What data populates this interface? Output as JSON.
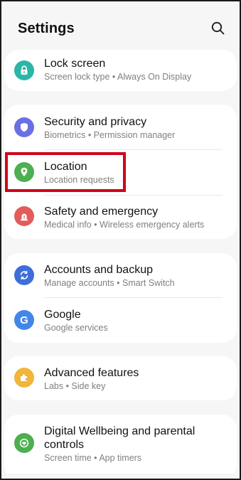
{
  "header": {
    "title": "Settings",
    "search_icon": "search-icon"
  },
  "groups": [
    {
      "items": [
        {
          "label": "Lock screen",
          "sub": "Screen lock type  •  Always On Display",
          "icon": "lock-icon",
          "color": "#2bb5a7"
        }
      ]
    },
    {
      "items": [
        {
          "label": "Security and privacy",
          "sub": "Biometrics  •  Permission manager",
          "icon": "shield-icon",
          "color": "#6a6fe3"
        },
        {
          "label": "Location",
          "sub": "Location requests",
          "icon": "location-pin-icon",
          "color": "#4caf50"
        },
        {
          "label": "Safety and emergency",
          "sub": "Medical info  •  Wireless emergency alerts",
          "icon": "alert-icon",
          "color": "#e25c5c"
        }
      ]
    },
    {
      "items": [
        {
          "label": "Accounts and backup",
          "sub": "Manage accounts  •  Smart Switch",
          "icon": "sync-icon",
          "color": "#3f6ed8"
        },
        {
          "label": "Google",
          "sub": "Google services",
          "icon": "google-icon",
          "color": "#4386ea"
        }
      ]
    },
    {
      "items": [
        {
          "label": "Advanced features",
          "sub": "Labs  •  Side key",
          "icon": "puzzle-icon",
          "color": "#f1b53a"
        }
      ]
    },
    {
      "items": [
        {
          "label": "Digital Wellbeing and parental",
          "label2": "controls",
          "sub": "Screen time  •  App timers",
          "icon": "wellbeing-icon",
          "color": "#4caf50"
        }
      ]
    }
  ],
  "highlight_color": "#d0021b"
}
